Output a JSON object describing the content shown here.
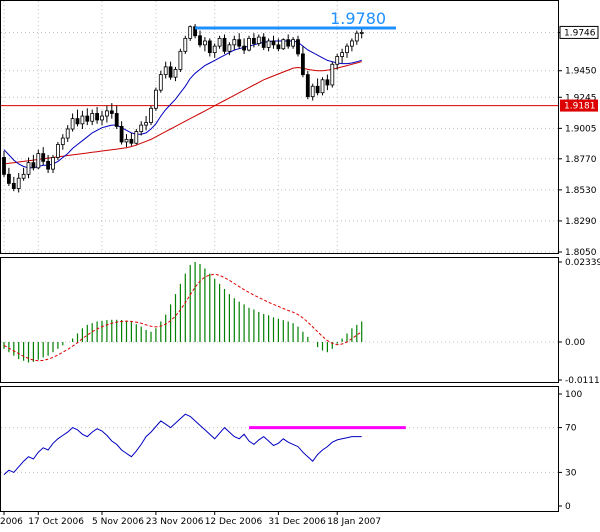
{
  "chart_data": [
    {
      "type": "candlestick",
      "ylim": [
        1.805,
        1.995
      ],
      "y_ticks": [
        "1.9745",
        "1.9450",
        "1.9245",
        "1.9005",
        "1.8770",
        "1.8530",
        "1.8290",
        "1.8050"
      ],
      "current_price_label": "1.9746",
      "h_line": {
        "value": 1.9181,
        "label": "1.9181",
        "color": "#dd0000"
      },
      "callout": {
        "text": "1.9780",
        "value": 1.978,
        "x_start_index": 39,
        "x_end_index": 80,
        "color": "#1e90ff"
      },
      "ohlc": [
        [
          1.878,
          1.883,
          1.863,
          1.865
        ],
        [
          1.865,
          1.87,
          1.856,
          1.858
        ],
        [
          1.858,
          1.863,
          1.852,
          1.854
        ],
        [
          1.854,
          1.866,
          1.851,
          1.862
        ],
        [
          1.862,
          1.87,
          1.86,
          1.865
        ],
        [
          1.865,
          1.878,
          1.862,
          1.874
        ],
        [
          1.874,
          1.88,
          1.868,
          1.87
        ],
        [
          1.87,
          1.884,
          1.869,
          1.881
        ],
        [
          1.881,
          1.886,
          1.872,
          1.875
        ],
        [
          1.875,
          1.88,
          1.866,
          1.869
        ],
        [
          1.869,
          1.88,
          1.866,
          1.878
        ],
        [
          1.878,
          1.89,
          1.876,
          1.888
        ],
        [
          1.888,
          1.896,
          1.884,
          1.893
        ],
        [
          1.893,
          1.903,
          1.89,
          1.9
        ],
        [
          1.9,
          1.912,
          1.898,
          1.908
        ],
        [
          1.908,
          1.915,
          1.902,
          1.904
        ],
        [
          1.904,
          1.914,
          1.9,
          1.91
        ],
        [
          1.91,
          1.916,
          1.903,
          1.906
        ],
        [
          1.906,
          1.915,
          1.903,
          1.912
        ],
        [
          1.912,
          1.917,
          1.904,
          1.907
        ],
        [
          1.907,
          1.914,
          1.903,
          1.91
        ],
        [
          1.91,
          1.918,
          1.905,
          1.914
        ],
        [
          1.914,
          1.92,
          1.908,
          1.912
        ],
        [
          1.912,
          1.918,
          1.9,
          1.902
        ],
        [
          1.902,
          1.906,
          1.888,
          1.89
        ],
        [
          1.89,
          1.896,
          1.886,
          1.892
        ],
        [
          1.892,
          1.897,
          1.887,
          1.889
        ],
        [
          1.889,
          1.9,
          1.888,
          1.898
        ],
        [
          1.898,
          1.906,
          1.895,
          1.903
        ],
        [
          1.903,
          1.91,
          1.899,
          1.905
        ],
        [
          1.905,
          1.918,
          1.903,
          1.916
        ],
        [
          1.916,
          1.932,
          1.914,
          1.93
        ],
        [
          1.93,
          1.945,
          1.928,
          1.942
        ],
        [
          1.942,
          1.952,
          1.939,
          1.948
        ],
        [
          1.948,
          1.952,
          1.938,
          1.94
        ],
        [
          1.94,
          1.948,
          1.937,
          1.946
        ],
        [
          1.946,
          1.962,
          1.944,
          1.96
        ],
        [
          1.96,
          1.972,
          1.958,
          1.97
        ],
        [
          1.97,
          1.98,
          1.968,
          1.979
        ],
        [
          1.979,
          1.981,
          1.97,
          1.972
        ],
        [
          1.972,
          1.976,
          1.963,
          1.965
        ],
        [
          1.965,
          1.971,
          1.96,
          1.968
        ],
        [
          1.968,
          1.97,
          1.956,
          1.959
        ],
        [
          1.959,
          1.966,
          1.955,
          1.964
        ],
        [
          1.964,
          1.972,
          1.962,
          1.97
        ],
        [
          1.97,
          1.973,
          1.958,
          1.96
        ],
        [
          1.96,
          1.967,
          1.957,
          1.965
        ],
        [
          1.965,
          1.972,
          1.961,
          1.969
        ],
        [
          1.969,
          1.974,
          1.962,
          1.964
        ],
        [
          1.964,
          1.97,
          1.958,
          1.961
        ],
        [
          1.961,
          1.972,
          1.96,
          1.97
        ],
        [
          1.97,
          1.974,
          1.963,
          1.966
        ],
        [
          1.966,
          1.973,
          1.964,
          1.971
        ],
        [
          1.971,
          1.974,
          1.961,
          1.963
        ],
        [
          1.963,
          1.97,
          1.96,
          1.968
        ],
        [
          1.968,
          1.972,
          1.962,
          1.965
        ],
        [
          1.965,
          1.97,
          1.96,
          1.962
        ],
        [
          1.962,
          1.97,
          1.961,
          1.969
        ],
        [
          1.969,
          1.973,
          1.962,
          1.964
        ],
        [
          1.964,
          1.971,
          1.962,
          1.969
        ],
        [
          1.969,
          1.972,
          1.956,
          1.958
        ],
        [
          1.958,
          1.964,
          1.94,
          1.942
        ],
        [
          1.942,
          1.945,
          1.923,
          1.925
        ],
        [
          1.925,
          1.935,
          1.922,
          1.933
        ],
        [
          1.933,
          1.939,
          1.926,
          1.928
        ],
        [
          1.928,
          1.94,
          1.926,
          1.938
        ],
        [
          1.938,
          1.942,
          1.93,
          1.934
        ],
        [
          1.934,
          1.952,
          1.932,
          1.95
        ],
        [
          1.95,
          1.958,
          1.946,
          1.956
        ],
        [
          1.956,
          1.962,
          1.951,
          1.959
        ],
        [
          1.959,
          1.966,
          1.955,
          1.964
        ],
        [
          1.964,
          1.97,
          1.96,
          1.968
        ],
        [
          1.968,
          1.976,
          1.965,
          1.974
        ],
        [
          1.974,
          1.979,
          1.97,
          1.9746
        ]
      ],
      "ma_fast": [
        1.884,
        1.88,
        1.876,
        1.873,
        1.871,
        1.87,
        1.87,
        1.871,
        1.872,
        1.872,
        1.873,
        1.875,
        1.878,
        1.881,
        1.885,
        1.888,
        1.891,
        1.894,
        1.897,
        1.899,
        1.901,
        1.902,
        1.903,
        1.903,
        1.901,
        1.899,
        1.897,
        1.896,
        1.896,
        1.897,
        1.9,
        1.904,
        1.91,
        1.915,
        1.919,
        1.923,
        1.928,
        1.933,
        1.939,
        1.943,
        1.946,
        1.949,
        1.951,
        1.953,
        1.955,
        1.957,
        1.959,
        1.961,
        1.962,
        1.963,
        1.964,
        1.965,
        1.966,
        1.967,
        1.9675,
        1.968,
        1.968,
        1.968,
        1.968,
        1.968,
        1.967,
        1.964,
        1.961,
        1.959,
        1.957,
        1.955,
        1.953,
        1.952,
        1.951,
        1.9505,
        1.9505,
        1.951,
        1.952,
        1.953
      ],
      "ma_slow": [
        1.873,
        1.8735,
        1.874,
        1.8745,
        1.875,
        1.8755,
        1.876,
        1.8765,
        1.877,
        1.8775,
        1.878,
        1.8785,
        1.879,
        1.8795,
        1.88,
        1.8805,
        1.881,
        1.8815,
        1.882,
        1.8825,
        1.883,
        1.8835,
        1.884,
        1.8845,
        1.885,
        1.8855,
        1.8865,
        1.8875,
        1.889,
        1.8905,
        1.892,
        1.894,
        1.896,
        1.898,
        1.9,
        1.902,
        1.904,
        1.906,
        1.908,
        1.91,
        1.912,
        1.914,
        1.916,
        1.918,
        1.92,
        1.922,
        1.924,
        1.926,
        1.928,
        1.93,
        1.932,
        1.934,
        1.936,
        1.938,
        1.9395,
        1.941,
        1.9425,
        1.944,
        1.9455,
        1.947,
        1.9475,
        1.947,
        1.946,
        1.9455,
        1.945,
        1.945,
        1.9455,
        1.946,
        1.947,
        1.948,
        1.949,
        1.95,
        1.951,
        1.952
      ]
    },
    {
      "type": "bar",
      "ylim": [
        -0.01112,
        0.02339
      ],
      "y_ticks": [
        "0.02339",
        "0.00",
        "-0.01112"
      ],
      "values": [
        -0.002,
        -0.003,
        -0.004,
        -0.005,
        -0.0055,
        -0.006,
        -0.0058,
        -0.0052,
        -0.0045,
        -0.004,
        -0.003,
        -0.002,
        -0.001,
        0.0,
        0.001,
        0.0025,
        0.004,
        0.005,
        0.0055,
        0.006,
        0.0062,
        0.0064,
        0.0065,
        0.0065,
        0.0064,
        0.0062,
        0.0058,
        0.0052,
        0.0045,
        0.0035,
        0.003,
        0.004,
        0.006,
        0.008,
        0.011,
        0.014,
        0.017,
        0.02,
        0.0225,
        0.0234,
        0.0228,
        0.0215,
        0.02,
        0.0185,
        0.017,
        0.0155,
        0.014,
        0.0128,
        0.0118,
        0.011,
        0.01,
        0.0095,
        0.0088,
        0.0082,
        0.0078,
        0.0072,
        0.0068,
        0.0064,
        0.006,
        0.0055,
        0.0045,
        0.003,
        0.0015,
        0.0,
        -0.0015,
        -0.0025,
        -0.003,
        -0.002,
        -0.0005,
        0.001,
        0.0025,
        0.004,
        0.005,
        0.006
      ],
      "signal": [
        -0.001,
        -0.0018,
        -0.0026,
        -0.0034,
        -0.0042,
        -0.0048,
        -0.0053,
        -0.0055,
        -0.0054,
        -0.005,
        -0.0045,
        -0.0038,
        -0.003,
        -0.0022,
        -0.0012,
        -0.0002,
        0.001,
        0.002,
        0.003,
        0.0038,
        0.0045,
        0.005,
        0.0055,
        0.0058,
        0.006,
        0.0061,
        0.006,
        0.0058,
        0.0055,
        0.005,
        0.0046,
        0.0044,
        0.0046,
        0.0052,
        0.0062,
        0.0076,
        0.0094,
        0.0115,
        0.0138,
        0.016,
        0.0178,
        0.019,
        0.0196,
        0.0198,
        0.0195,
        0.0188,
        0.018,
        0.0171,
        0.0162,
        0.0153,
        0.0145,
        0.0137,
        0.013,
        0.0123,
        0.0116,
        0.011,
        0.0104,
        0.0098,
        0.0092,
        0.0087,
        0.008,
        0.007,
        0.0058,
        0.0044,
        0.003,
        0.0016,
        0.0004,
        -0.0004,
        -0.0008,
        -0.0006,
        0.0,
        0.001,
        0.002,
        0.003
      ]
    },
    {
      "type": "line",
      "ylim": [
        0,
        100
      ],
      "y_ticks": [
        "100",
        "70",
        "30",
        "0"
      ],
      "values": [
        28,
        32,
        30,
        35,
        40,
        44,
        42,
        48,
        52,
        50,
        56,
        60,
        63,
        66,
        70,
        68,
        64,
        62,
        66,
        69,
        67,
        63,
        58,
        55,
        50,
        47,
        44,
        49,
        55,
        62,
        66,
        71,
        76,
        73,
        70,
        74,
        78,
        82,
        80,
        76,
        72,
        68,
        64,
        60,
        65,
        70,
        66,
        62,
        60,
        64,
        58,
        55,
        59,
        62,
        58,
        54,
        56,
        60,
        57,
        55,
        53,
        48,
        44,
        40,
        46,
        50,
        53,
        57,
        59,
        60,
        61,
        62,
        62,
        62
      ],
      "h_line": {
        "value": 70,
        "x_start_index": 50,
        "x_end_index": 82,
        "color": "#ff00ff"
      }
    }
  ],
  "x_axis": {
    "labels": [
      "2006",
      "17 Oct 2006",
      "5 Nov 2006",
      "23 Nov 2006",
      "12 Dec 2006",
      "31 Dec 2006",
      "18 Jan 2007"
    ],
    "label_indices": [
      0,
      7,
      20,
      31,
      43,
      56,
      68
    ]
  },
  "colors": {
    "ma_fast": "#0000c0",
    "ma_slow": "#cc0000",
    "histogram": "#008000",
    "signal": "#e00000",
    "line": "#0000c0",
    "candle": "#000000",
    "grid": "#c0c0c0"
  }
}
